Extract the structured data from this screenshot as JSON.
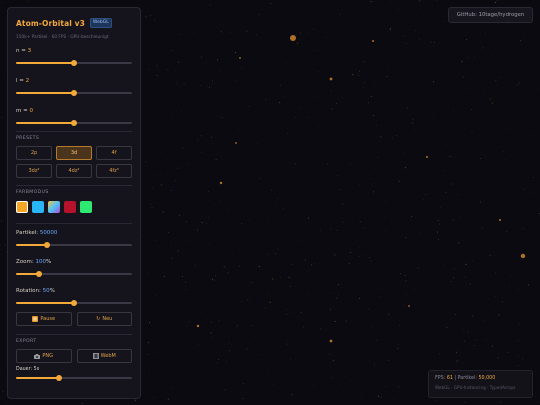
{
  "panel": {
    "title": "Atom-Orbital v3",
    "badge": "WebGL",
    "subtitle": "150k+ Partikel · 60 FPS · GPU-beschleunigt",
    "quantum": [
      {
        "label": "n = ",
        "value": "3",
        "fraction": 0.5
      },
      {
        "label": "l = ",
        "value": "2",
        "fraction": 0.5
      },
      {
        "label": "m = ",
        "value": "0",
        "fraction": 0.5
      }
    ],
    "presets_title": "PRESETS",
    "presets": [
      {
        "label": "2p",
        "active": false
      },
      {
        "label": "3d",
        "active": true
      },
      {
        "label": "4f",
        "active": false
      },
      {
        "label": "3dz²",
        "active": false
      },
      {
        "label": "4dz²",
        "active": false
      },
      {
        "label": "4fz³",
        "active": false
      }
    ],
    "color_title": "FARBMODUS",
    "swatches": [
      {
        "color": "#f5a623",
        "active": true
      },
      {
        "color": "#29b6f6",
        "active": false
      },
      {
        "color": "#7e8ce0",
        "active": false
      },
      {
        "color": "#b5122b",
        "active": false
      },
      {
        "color": "#2ee872",
        "active": false
      }
    ],
    "particles": {
      "label": "Partikel: ",
      "value": "50000",
      "fraction": 0.27
    },
    "zoom": {
      "label": "Zoom: ",
      "value": "100",
      "unit": "%",
      "fraction": 0.2
    },
    "rotation": {
      "label": "Rotation: ",
      "value": "50",
      "unit": "%",
      "fraction": 0.5
    },
    "pause_label": "Pause",
    "reset_label": "Neu",
    "export_title": "EXPORT",
    "png_label": "PNG",
    "webm_label": "WebM",
    "duration": {
      "label": "Dauer: ",
      "value": "5s",
      "fraction": 0.37
    }
  },
  "github_label": "GitHub: 10tage/hydrogen",
  "status": {
    "fps_label": "FPS: ",
    "fps_value": "61",
    "sep": " | ",
    "particles_label": "Partikel: ",
    "particles_value": "50,000",
    "renderer": "WebGL · GPU-Instancing · TypedArrays"
  },
  "colors": {
    "accent": "#f3a93a",
    "background": "#0b0a10",
    "panel": "#15141c",
    "link_blue": "#6aa8ff"
  }
}
